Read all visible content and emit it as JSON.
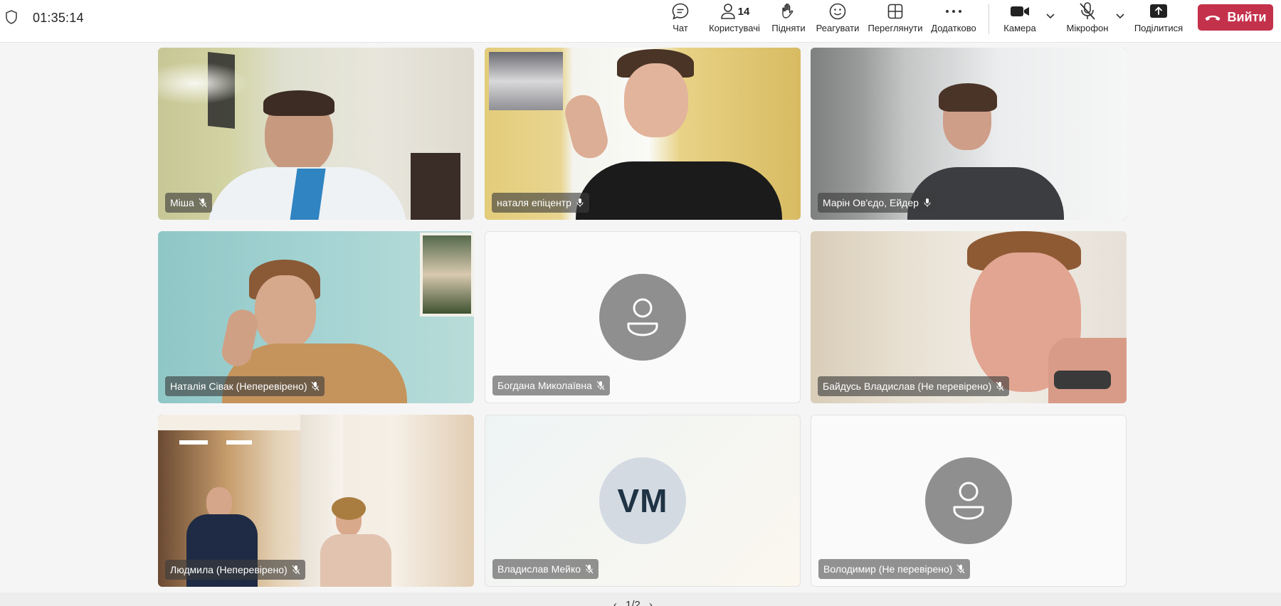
{
  "meeting": {
    "timer": "01:35:14"
  },
  "toolbar": {
    "chat_label": "Чат",
    "people_label": "Користувачі",
    "people_count": "14",
    "raise_label": "Підняти",
    "react_label": "Реагувати",
    "view_label": "Переглянути",
    "more_label": "Додатково",
    "camera_label": "Камера",
    "mic_label": "Мікрофон",
    "share_label": "Поділитися",
    "leave_label": "Вийти"
  },
  "participants": [
    {
      "name": "Міша"
    },
    {
      "name": "наталя епіцентр"
    },
    {
      "name": "Марін Ов'єдо, Ейдер"
    },
    {
      "name": "Наталія Сівак (Неперевірено)"
    },
    {
      "name": "Богдана Миколаївна"
    },
    {
      "name": "Байдусь Владислав (Не перевірено)"
    },
    {
      "name": "Людмила (Неперевірено)"
    },
    {
      "name": "Владислав Мейко",
      "initials": "VM"
    },
    {
      "name": "Володимир (Не перевірено)"
    }
  ],
  "pagination": {
    "prev": "‹",
    "page": "1/2",
    "next": "›"
  },
  "colors": {
    "accent": "#6264a7",
    "leave": "#c4314b",
    "avatar_gray": "#8f8f8f"
  }
}
